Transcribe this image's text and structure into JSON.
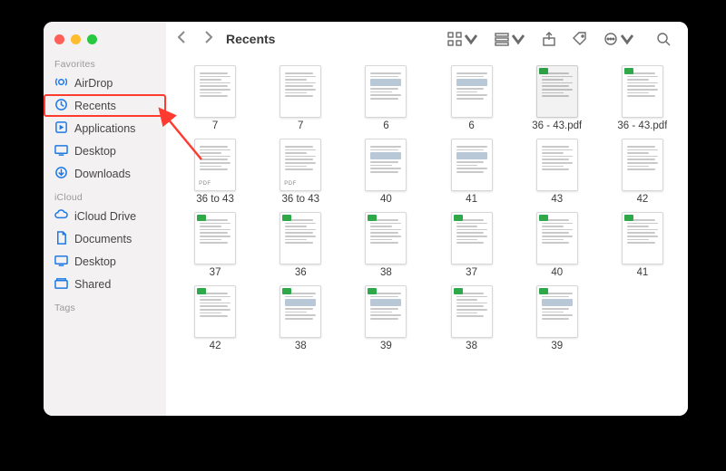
{
  "window_title": "Recents",
  "sidebar": {
    "sections": [
      {
        "label": "Favorites",
        "items": [
          {
            "icon": "airdrop-icon",
            "label": "AirDrop"
          },
          {
            "icon": "recents-icon",
            "label": "Recents",
            "highlighted": true
          },
          {
            "icon": "applications-icon",
            "label": "Applications"
          },
          {
            "icon": "desktop-icon",
            "label": "Desktop"
          },
          {
            "icon": "downloads-icon",
            "label": "Downloads"
          }
        ]
      },
      {
        "label": "iCloud",
        "items": [
          {
            "icon": "icloud-icon",
            "label": "iCloud Drive"
          },
          {
            "icon": "documents-icon",
            "label": "Documents"
          },
          {
            "icon": "desktop-icon",
            "label": "Desktop"
          },
          {
            "icon": "shared-icon",
            "label": "Shared"
          }
        ]
      },
      {
        "label": "Tags",
        "items": []
      }
    ]
  },
  "files": [
    {
      "name": "7",
      "greenCorner": false,
      "hasBlock": false,
      "pdfBadge": false,
      "dark": false
    },
    {
      "name": "7",
      "greenCorner": false,
      "hasBlock": false,
      "pdfBadge": false,
      "dark": false
    },
    {
      "name": "6",
      "greenCorner": false,
      "hasBlock": true,
      "pdfBadge": false,
      "dark": false
    },
    {
      "name": "6",
      "greenCorner": false,
      "hasBlock": true,
      "pdfBadge": false,
      "dark": false
    },
    {
      "name": "36 - 43.pdf",
      "greenCorner": true,
      "hasBlock": false,
      "pdfBadge": false,
      "dark": true
    },
    {
      "name": "36 - 43.pdf",
      "greenCorner": true,
      "hasBlock": false,
      "pdfBadge": false,
      "dark": false
    },
    {
      "name": "36 to 43",
      "greenCorner": false,
      "hasBlock": false,
      "pdfBadge": true,
      "dark": false
    },
    {
      "name": "36 to 43",
      "greenCorner": false,
      "hasBlock": false,
      "pdfBadge": true,
      "dark": false
    },
    {
      "name": "40",
      "greenCorner": false,
      "hasBlock": true,
      "pdfBadge": false,
      "dark": false
    },
    {
      "name": "41",
      "greenCorner": false,
      "hasBlock": true,
      "pdfBadge": false,
      "dark": false
    },
    {
      "name": "43",
      "greenCorner": false,
      "hasBlock": false,
      "pdfBadge": false,
      "dark": false
    },
    {
      "name": "42",
      "greenCorner": false,
      "hasBlock": false,
      "pdfBadge": false,
      "dark": false
    },
    {
      "name": "37",
      "greenCorner": true,
      "hasBlock": false,
      "pdfBadge": false,
      "dark": false
    },
    {
      "name": "36",
      "greenCorner": true,
      "hasBlock": false,
      "pdfBadge": false,
      "dark": false
    },
    {
      "name": "38",
      "greenCorner": true,
      "hasBlock": false,
      "pdfBadge": false,
      "dark": false
    },
    {
      "name": "37",
      "greenCorner": true,
      "hasBlock": false,
      "pdfBadge": false,
      "dark": false
    },
    {
      "name": "40",
      "greenCorner": true,
      "hasBlock": false,
      "pdfBadge": false,
      "dark": false
    },
    {
      "name": "41",
      "greenCorner": true,
      "hasBlock": false,
      "pdfBadge": false,
      "dark": false
    },
    {
      "name": "42",
      "greenCorner": true,
      "hasBlock": false,
      "pdfBadge": false,
      "dark": false
    },
    {
      "name": "38",
      "greenCorner": true,
      "hasBlock": true,
      "pdfBadge": false,
      "dark": false
    },
    {
      "name": "39",
      "greenCorner": true,
      "hasBlock": true,
      "pdfBadge": false,
      "dark": false
    },
    {
      "name": "38",
      "greenCorner": true,
      "hasBlock": false,
      "pdfBadge": false,
      "dark": false
    },
    {
      "name": "39",
      "greenCorner": true,
      "hasBlock": true,
      "pdfBadge": false,
      "dark": false
    }
  ],
  "annotation": {
    "highlight_target": "Recents",
    "arrow_color": "#ff3b30"
  }
}
